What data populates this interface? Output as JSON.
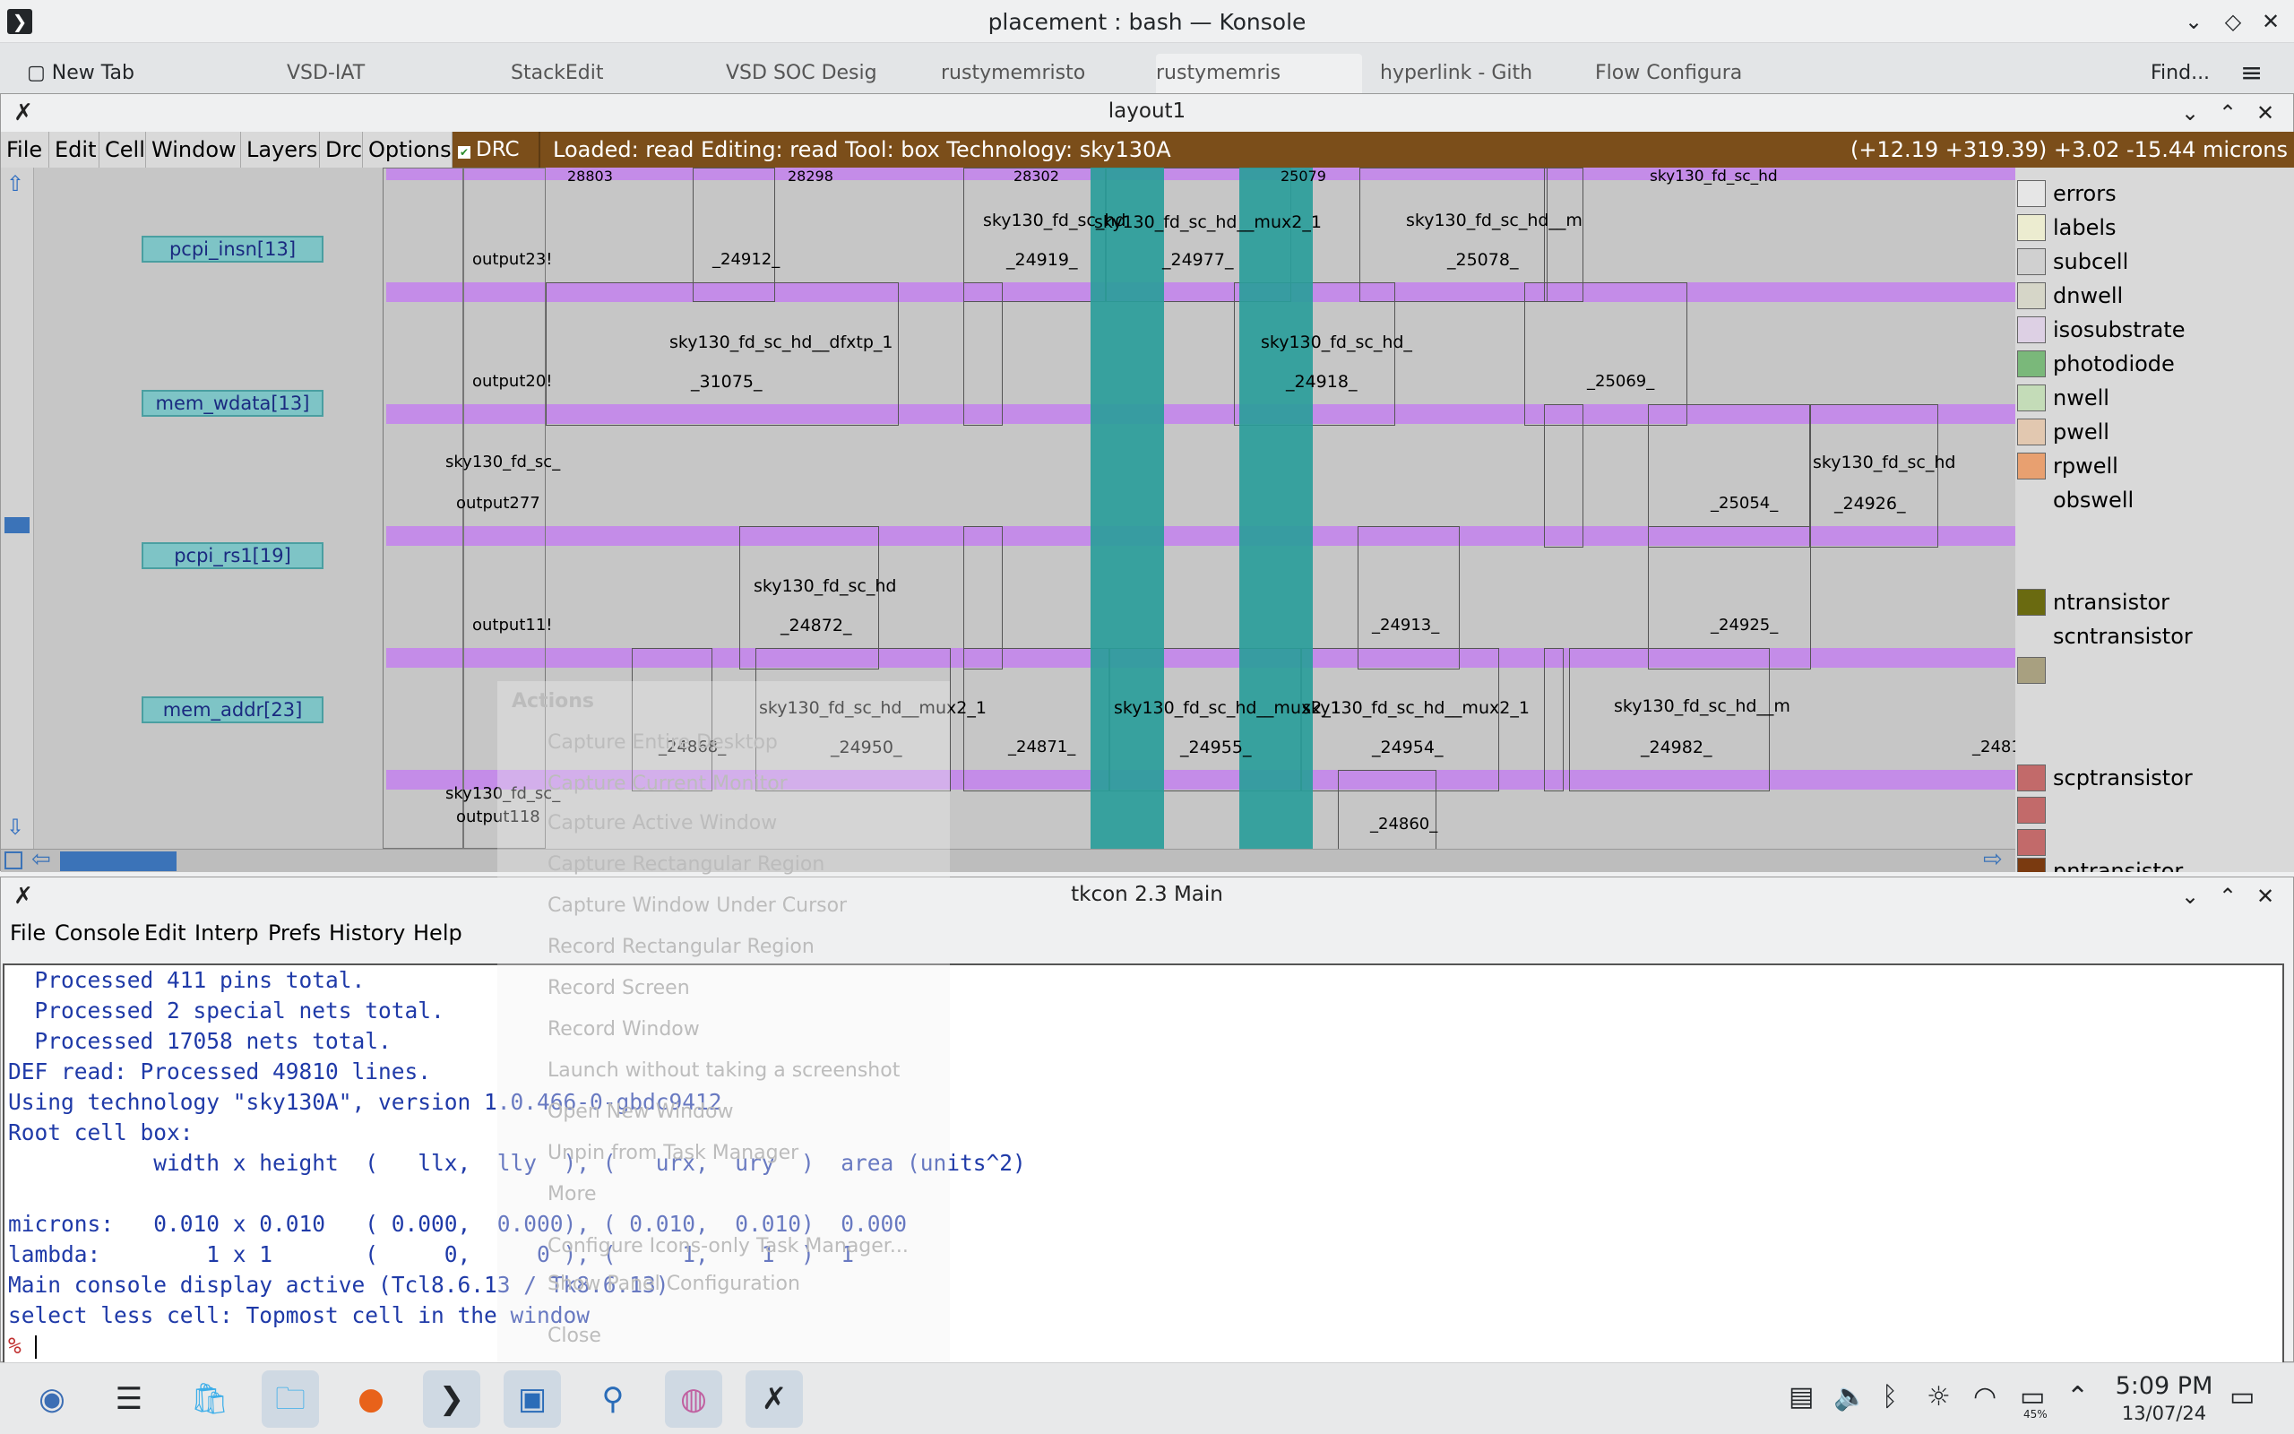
{
  "konsole": {
    "title": "placement : bash — Konsole",
    "tabs": [
      "New Tab",
      "VSD-IAT",
      "StackEdit",
      "VSD SOC Desig",
      "rustymemristo",
      "rustymemris",
      "hyperlink - Gith",
      "Flow Configura"
    ],
    "find_label": "Find..."
  },
  "layout_window": {
    "title": "layout1",
    "menus": [
      "File",
      "Edit",
      "Cell",
      "Window",
      "Layers",
      "Drc",
      "Options"
    ],
    "drc_label": "DRC",
    "status": "Loaded: read Editing: read Tool: box  Technology: sky130A",
    "coords": "(+12.19 +319.39) +3.02 -15.44 microns",
    "pin_labels": [
      "pcpi_insn[13]",
      "mem_wdata[13]",
      "pcpi_rs1[19]",
      "mem_addr[23]"
    ],
    "cells": [
      {
        "n1": "sky130_fd_sc_hd",
        "n2": "_24919_"
      },
      {
        "n1": "sky130_fd_sc_hd__mux2_1",
        "n2": "_24977_"
      },
      {
        "n1": "sky130_fd_sc_hd__m",
        "n2": "_25078_"
      },
      {
        "n1": "sky130_fd_sc_hd__dfxtp_1",
        "n2": "_31075_"
      },
      {
        "n1": "sky130_fd_sc_hd_",
        "n2": "_24918_"
      },
      {
        "n1": "sky130_fd_sc_hd",
        "n2": "_24926_"
      },
      {
        "n1": "sky130_fd_sc_hd",
        "n2": "_24872_"
      },
      {
        "n1": "sky130_fd_sc_hd__mux2_1",
        "n2": "_24950_"
      },
      {
        "n1": "sky130_fd_sc_hd__mux2_1",
        "n2": "_24955_"
      },
      {
        "n1": "sky130_fd_sc_hd__mux2_1",
        "n2": "_24954_"
      },
      {
        "n1": "sky130_fd_sc_hd__m",
        "n2": "_24982_"
      }
    ],
    "small_labels": {
      "output1": "output23!",
      "output2": "output20!",
      "output3": "output277",
      "output4": "output11!",
      "output5": "output118",
      "sc1": "sky130_fd_sc_",
      "sc2": "sky130_fd_sc_",
      "id1": "_24912_",
      "id2": "_25069_",
      "id3": "_25054_",
      "id4": "_24913_",
      "id5": "_24925_",
      "id6": "_24868_",
      "id7": "_24871_",
      "id8": "_24860_",
      "id9": "_2481",
      "top1": "28803",
      "top2": "28298",
      "top3": "28302",
      "top4": "25079",
      "top5": "sky130_fd_sc_hd"
    },
    "legend": [
      {
        "label": "errors",
        "color": "#e6e6e6"
      },
      {
        "label": "labels",
        "color": "#ececd0"
      },
      {
        "label": "subcell",
        "color": "#d0d0d0"
      },
      {
        "label": "dnwell",
        "color": "#d6d6c8"
      },
      {
        "label": "isosubstrate",
        "color": "#ddd0e4"
      },
      {
        "label": "photodiode",
        "color": "#7ab87a"
      },
      {
        "label": "nwell",
        "color": "#c4dcb8"
      },
      {
        "label": "pwell",
        "color": "#e2c8b0"
      },
      {
        "label": "rpwell",
        "color": "#e8a070"
      },
      {
        "label": "obswell",
        "color": ""
      },
      {
        "label": "ntransistor",
        "color": "#6a6a10"
      },
      {
        "label": "scntransistor",
        "color": ""
      },
      {
        "label": "scptransistor",
        "color": "#c26a6a"
      },
      {
        "label": "pntransistor",
        "color": "#7a3a10"
      }
    ]
  },
  "tkcon": {
    "title": "tkcon 2.3 Main",
    "menus": [
      "File",
      "Console",
      "Edit",
      "Interp",
      "Prefs",
      "History",
      "Help"
    ],
    "lines": [
      "  Processed 411 pins total.",
      "  Processed 2 special nets total.",
      "  Processed 17058 nets total.",
      "DEF read: Processed 49810 lines.",
      "Using technology \"sky130A\", version 1.0.466-0-gbdc9412",
      "Root cell box:",
      "           width x height  (   llx,  lly  ), (   urx,  ury  )  area (units^2)",
      "",
      "microns:   0.010 x 0.010   ( 0.000,  0.000), ( 0.010,  0.010)  0.000",
      "lambda:        1 x 1       (     0,     0 ), (     1,    1  )  1",
      "Main console display active (Tcl8.6.13 / Tk8.6.13)",
      "select less cell: Topmost cell in the window"
    ],
    "prompt": "%"
  },
  "ghost_menu": {
    "header": "Actions",
    "items": [
      "Capture Entire Desktop",
      "Capture Current Monitor",
      "Capture Active Window",
      "Capture Rectangular Region",
      "Capture Window Under Cursor",
      "Record Rectangular Region",
      "Record Screen",
      "Record Window",
      "Launch without taking a screenshot",
      "Open New Window",
      "Unpin from Task Manager",
      "More",
      "Configure Icons-only Task Manager...",
      "Show Panel Configuration",
      "Close"
    ]
  },
  "taskbar": {
    "time": "5:09 PM",
    "date": "13/07/24",
    "battery": "45%"
  }
}
